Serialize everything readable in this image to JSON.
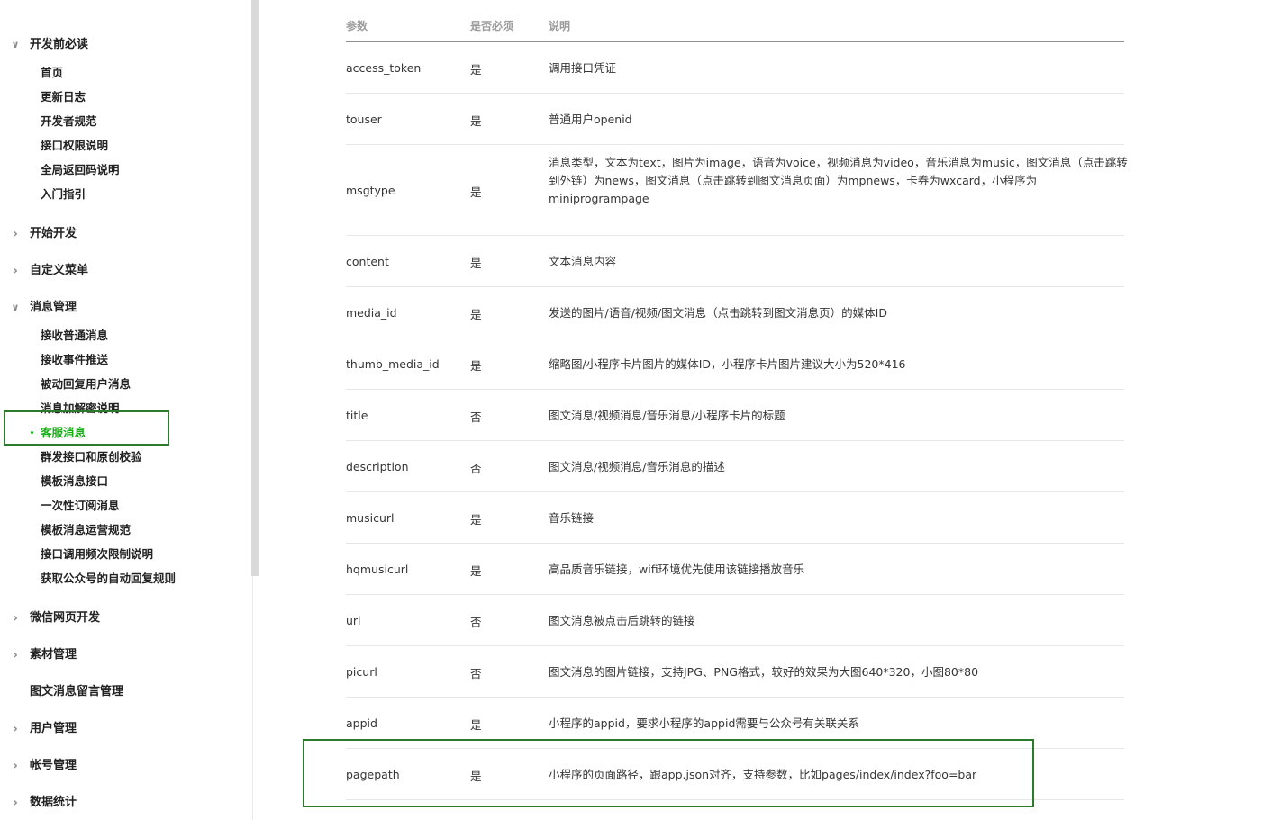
{
  "sidebar": {
    "groups": [
      {
        "title": "开发前必读",
        "expanded": true,
        "items": [
          "首页",
          "更新日志",
          "开发者规范",
          "接口权限说明",
          "全局返回码说明",
          "入门指引"
        ]
      },
      {
        "title": "开始开发",
        "expanded": false,
        "items": []
      },
      {
        "title": "自定义菜单",
        "expanded": false,
        "items": []
      },
      {
        "title": "消息管理",
        "expanded": true,
        "items": [
          "接收普通消息",
          "接收事件推送",
          "被动回复用户消息",
          "消息加解密说明",
          "客服消息",
          "群发接口和原创校验",
          "模板消息接口",
          "一次性订阅消息",
          "模板消息运营规范",
          "接口调用频次限制说明",
          "获取公众号的自动回复规则"
        ],
        "active": "客服消息"
      },
      {
        "title": "微信网页开发",
        "expanded": false,
        "items": []
      },
      {
        "title": "素材管理",
        "expanded": false,
        "items": []
      },
      {
        "title": "图文消息留言管理",
        "expanded": false,
        "no_chevron": true,
        "items": []
      },
      {
        "title": "用户管理",
        "expanded": false,
        "items": []
      },
      {
        "title": "帐号管理",
        "expanded": false,
        "items": []
      },
      {
        "title": "数据统计",
        "expanded": false,
        "items": []
      }
    ]
  },
  "table": {
    "headers": {
      "param": "参数",
      "required": "是否必须",
      "desc": "说明"
    },
    "rows": [
      {
        "param": "access_token",
        "required": "是",
        "desc": [
          "调用接口凭证"
        ]
      },
      {
        "param": "touser",
        "required": "是",
        "desc": [
          "普通用户openid"
        ]
      },
      {
        "param": "msgtype",
        "required": "是",
        "desc": [
          "消息类型，文本为text，图片为image，语音为voice，视频消息为video，音乐消息为music，图文消息（点击跳转",
          "到外链）为news，图文消息（点击跳转到图文消息页面）为mpnews，卡券为wxcard，小程序为",
          "miniprogrampage"
        ]
      },
      {
        "param": "content",
        "required": "是",
        "desc": [
          "文本消息内容"
        ]
      },
      {
        "param": "media_id",
        "required": "是",
        "desc": [
          "发送的图片/语音/视频/图文消息（点击跳转到图文消息页）的媒体ID"
        ]
      },
      {
        "param": "thumb_media_id",
        "required": "是",
        "desc": [
          "缩略图/小程序卡片图片的媒体ID，小程序卡片图片建议大小为520*416"
        ]
      },
      {
        "param": "title",
        "required": "否",
        "desc": [
          "图文消息/视频消息/音乐消息/小程序卡片的标题"
        ]
      },
      {
        "param": "description",
        "required": "否",
        "desc": [
          "图文消息/视频消息/音乐消息的描述"
        ]
      },
      {
        "param": "musicurl",
        "required": "是",
        "desc": [
          "音乐链接"
        ]
      },
      {
        "param": "hqmusicurl",
        "required": "是",
        "desc": [
          "高品质音乐链接，wifi环境优先使用该链接播放音乐"
        ]
      },
      {
        "param": "url",
        "required": "否",
        "desc": [
          "图文消息被点击后跳转的链接"
        ]
      },
      {
        "param": "picurl",
        "required": "否",
        "desc": [
          "图文消息的图片链接，支持JPG、PNG格式，较好的效果为大图640*320，小图80*80"
        ]
      },
      {
        "param": "appid",
        "required": "是",
        "desc": [
          "小程序的appid，要求小程序的appid需要与公众号有关联关系"
        ]
      },
      {
        "param": "pagepath",
        "required": "是",
        "desc": [
          "小程序的页面路径，跟app.json对齐，支持参数，比如pages/index/index?foo=bar"
        ]
      }
    ]
  },
  "colors": {
    "accent": "#1AAD19",
    "highlight_box": "#2a7b2a"
  }
}
